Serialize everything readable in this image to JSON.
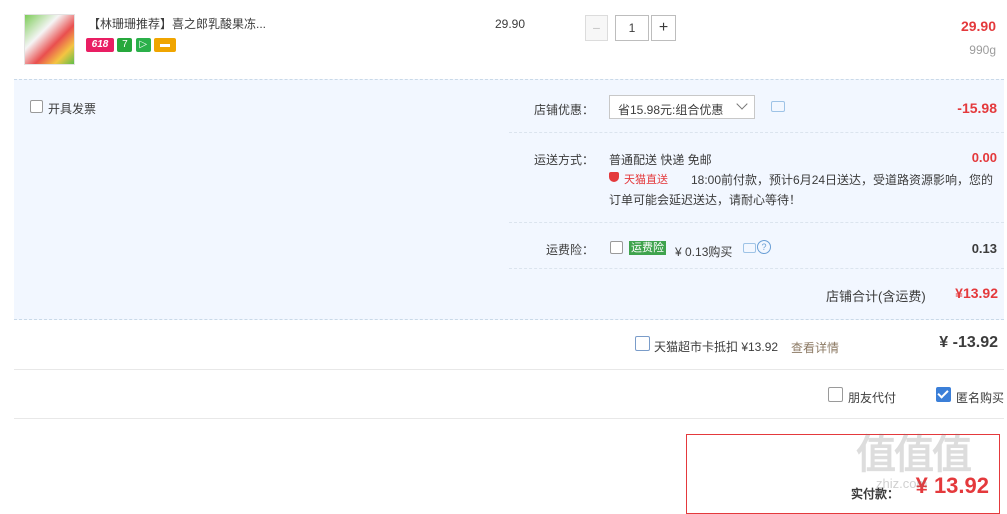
{
  "item": {
    "title": "【林珊珊推荐】喜之郎乳酸果冻...",
    "unit_price": "29.90",
    "quantity": "1",
    "minus": "−",
    "plus": "+",
    "subtotal": "29.90",
    "weight": "990g",
    "badge_618": "618",
    "badge_7": "7"
  },
  "invoice": {
    "label": "开具发票"
  },
  "shop_discount": {
    "label": "店铺优惠：",
    "select_value": "省15.98元:组合优惠",
    "amount": "-15.98"
  },
  "shipping": {
    "label": "运送方式：",
    "method": "普通配送 快递 免邮",
    "amount": "0.00",
    "tmall_tag": "天猫直送",
    "notice_line1": "18:00前付款，预计6月24日送达，受道路资源影响，您的",
    "notice_line2": "订单可能会延迟送达，请耐心等待！"
  },
  "insurance": {
    "label": "运费险：",
    "tag": "运费险",
    "price": "¥ 0.13购买",
    "amount": "0.13"
  },
  "shop_total": {
    "label": "店铺合计(含运费)",
    "amount": "¥13.92"
  },
  "card_deduction": {
    "label": "天猫超市卡抵扣 ¥13.92",
    "link": "查看详情",
    "amount": "¥ -13.92"
  },
  "options": {
    "friend_pay": "朋友代付",
    "anonymous": "匿名购买"
  },
  "summary": {
    "pay_label": "实付款：",
    "pay_amount": "¥ 13.92"
  },
  "watermark": {
    "text": "值值值",
    "url": "zhiz.com"
  },
  "colors": {
    "accent_red": "#e4393c",
    "blue_bg": "#f2f7ff",
    "link_gray": "#8c7a64"
  }
}
